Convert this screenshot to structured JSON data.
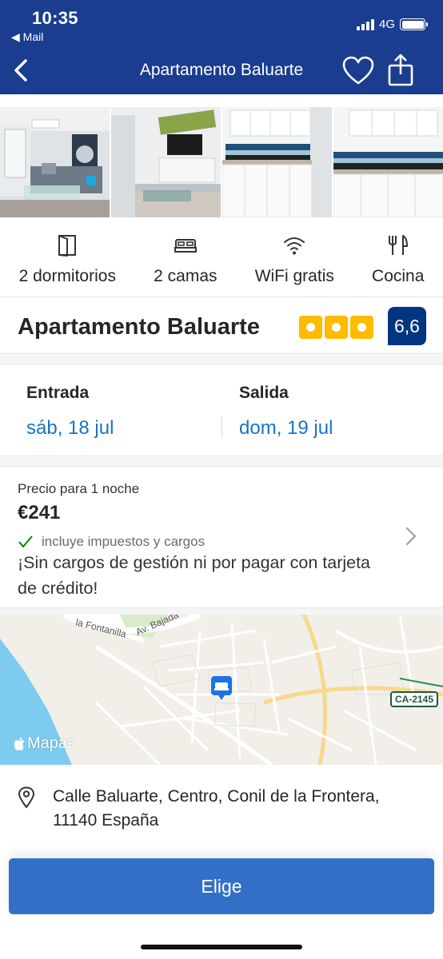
{
  "status_bar": {
    "time": "10:35",
    "back_app": "◀ Mail",
    "network": "4G"
  },
  "nav": {
    "title": "Apartamento Baluarte"
  },
  "photos": [
    "living-room-photo",
    "tv-room-photo",
    "kitchen-photo",
    "kitchen-detail-photo"
  ],
  "facilities": [
    {
      "icon": "door-icon",
      "label": "2 dormitorios"
    },
    {
      "icon": "bed-icon",
      "label": "2 camas"
    },
    {
      "icon": "wifi-icon",
      "label": "WiFi gratis"
    },
    {
      "icon": "cutlery-icon",
      "label": "Cocina"
    }
  ],
  "hotel": {
    "name": "Apartamento Baluarte",
    "stars": 3,
    "score": "6,6"
  },
  "dates": {
    "checkin_label": "Entrada",
    "checkin_value": "sáb, 18 jul",
    "checkout_label": "Salida",
    "checkout_value": "dom, 19 jul"
  },
  "price": {
    "label": "Precio para 1 noche",
    "value": "€241",
    "tax_note": "incluye impuestos y cargos",
    "fee_note": "¡Sin cargos de gestión ni por pagar con tarjeta de crédito!"
  },
  "map": {
    "logo": "Mapas",
    "road_badge": "CA-2145",
    "road_labels": [
      "Av. Bajada",
      "la Fontanilla"
    ]
  },
  "address": {
    "text": "Calle Baluarte, Centro, Conil de la Frontera, 11140 España"
  },
  "cta": {
    "label": "Elige"
  },
  "colors": {
    "brand": "#1a3d8f",
    "score_bg": "#003580",
    "star": "#febb02",
    "link": "#1a73c8",
    "button": "#3270c7"
  }
}
